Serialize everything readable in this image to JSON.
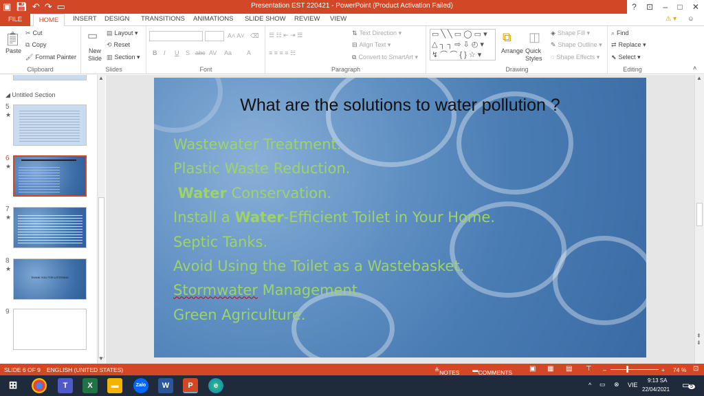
{
  "window": {
    "title": "Presentation EST 220421 - PowerPoint (Product Activation Failed)",
    "help": "?",
    "controls": [
      "–",
      "□",
      "✕"
    ]
  },
  "tabs": [
    "FILE",
    "HOME",
    "INSERT",
    "DESIGN",
    "TRANSITIONS",
    "ANIMATIONS",
    "SLIDE SHOW",
    "REVIEW",
    "VIEW"
  ],
  "ribbon": {
    "clipboard": {
      "paste": "Paste",
      "cut": "Cut",
      "copy": "Copy",
      "format_painter": "Format Painter",
      "label": "Clipboard"
    },
    "slides": {
      "new_slide": "New Slide",
      "layout": "Layout",
      "reset": "Reset",
      "section": "Section",
      "label": "Slides"
    },
    "font": {
      "label": "Font",
      "bold": "B",
      "italic": "I",
      "underline": "U",
      "shadow": "S",
      "strike": "abc",
      "spacing": "AV",
      "case": "Aa",
      "color": "A"
    },
    "paragraph": {
      "label": "Paragraph",
      "text_direction": "Text Direction",
      "align_text": "Align Text",
      "smartart": "Convert to SmartArt"
    },
    "drawing": {
      "label": "Drawing",
      "arrange": "Arrange",
      "quick_styles": "Quick Styles",
      "shape_fill": "Shape Fill",
      "shape_outline": "Shape Outline",
      "shape_effects": "Shape Effects"
    },
    "editing": {
      "label": "Editing",
      "find": "Find",
      "replace": "Replace",
      "select": "Select"
    }
  },
  "left_panel": {
    "section": "Untitled Section",
    "slides": [
      {
        "num": "5",
        "star": "★"
      },
      {
        "num": "6",
        "star": "★"
      },
      {
        "num": "7",
        "star": "★"
      },
      {
        "num": "8",
        "star": "★",
        "text": "THANK YOU FOR LISTENING"
      },
      {
        "num": "9",
        "star": ""
      }
    ]
  },
  "slide": {
    "title": "What are the solutions to water pollution ?",
    "bullets": [
      {
        "pre": "Wastewater Treatment.",
        "bold": "",
        "post": ""
      },
      {
        "pre": "Plastic Waste Reduction.",
        "bold": "",
        "post": ""
      },
      {
        "pre": " ",
        "bold": "Water",
        "post": " Conservation."
      },
      {
        "pre": "Install a ",
        "bold": "Water",
        "post": "-Efficient Toilet in Your Home."
      },
      {
        "pre": "Septic Tanks.",
        "bold": "",
        "post": ""
      },
      {
        "pre": "Avoid Using the Toilet as a Wastebasket.",
        "bold": "",
        "post": ""
      },
      {
        "pre": "Stormwater",
        "bold": "",
        "post": " Management."
      },
      {
        "pre": "Green Agriculture.",
        "bold": "",
        "post": ""
      }
    ]
  },
  "status": {
    "slide": "SLIDE 6 OF 9",
    "language": "ENGLISH (UNITED STATES)",
    "notes": "NOTES",
    "comments": "COMMENTS",
    "zoom_minus": "–",
    "zoom_plus": "+",
    "zoom": "74 %"
  },
  "taskbar": {
    "apps": [
      "Windows",
      "Chrome",
      "Teams",
      "Excel",
      "Files",
      "Zalo",
      "Word",
      "PowerPoint",
      "Edge"
    ],
    "lang": "VIE",
    "time": "9:13 SA",
    "date": "22/04/2021",
    "notifications": "5"
  },
  "colors": {
    "accent": "#d24726",
    "bullet_text": "#9ed36a",
    "slide_bg": "#4a7cb4"
  }
}
